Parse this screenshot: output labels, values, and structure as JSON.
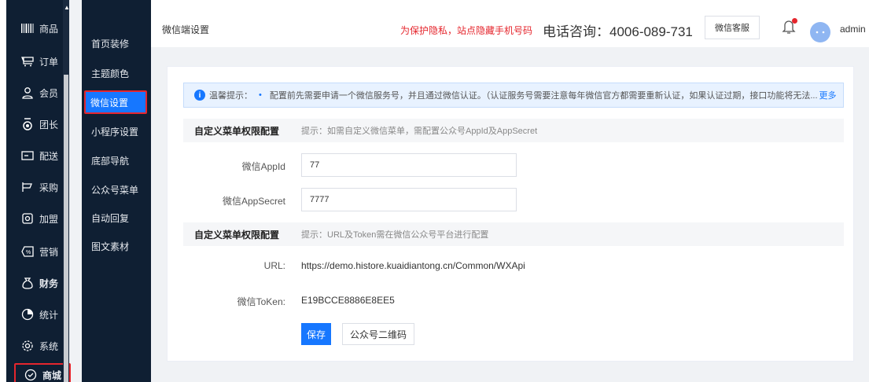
{
  "sidebar": {
    "items": [
      {
        "label": "商品",
        "icon": "barcode-icon"
      },
      {
        "label": "订单",
        "icon": "cart-icon"
      },
      {
        "label": "会员",
        "icon": "user-icon"
      },
      {
        "label": "团长",
        "icon": "leader-icon"
      },
      {
        "label": "配送",
        "icon": "truck-icon"
      },
      {
        "label": "采购",
        "icon": "purchase-icon"
      },
      {
        "label": "加盟",
        "icon": "franchise-icon"
      },
      {
        "label": "营销",
        "icon": "discount-icon"
      },
      {
        "label": "财务",
        "icon": "finance-icon"
      },
      {
        "label": "统计",
        "icon": "chart-icon"
      },
      {
        "label": "系统",
        "icon": "gear-icon"
      },
      {
        "label": "商城",
        "icon": "shop-icon"
      }
    ]
  },
  "subnav": {
    "items": [
      {
        "label": "首页装修"
      },
      {
        "label": "主题颜色"
      },
      {
        "label": "微信设置"
      },
      {
        "label": "小程序设置"
      },
      {
        "label": "底部导航"
      },
      {
        "label": "公众号菜单"
      },
      {
        "label": "自动回复"
      },
      {
        "label": "图文素材"
      }
    ]
  },
  "header": {
    "title": "微信端设置",
    "privacy_notice": "为保护隐私，站点隐藏手机号码",
    "phone": "电话咨询：4006-089-731",
    "service_button": "微信客服",
    "username": "admin"
  },
  "tip": {
    "title": "温馨提示：",
    "text": "配置前先需要申请一个微信服务号，并且通过微信认证。（认证服务号需要注意每年微信官方都需要重新认证，如果认证过期，接口功能将无法...",
    "more": "更多"
  },
  "section1": {
    "title": "自定义菜单权限配置",
    "hint": "提示：如需自定义微信菜单，需配置公众号AppId及AppSecret"
  },
  "form": {
    "appid_label": "微信AppId",
    "appid_value": "77",
    "secret_label": "微信AppSecret",
    "secret_value": "7777"
  },
  "section2": {
    "title": "自定义菜单权限配置",
    "hint": "提示：URL及Token需在微信公众号平台进行配置"
  },
  "info": {
    "url_label": "URL:",
    "url_value": "https://demo.histore.kuaidiantong.cn/Common/WXApi",
    "token_label": "微信ToKen:",
    "token_value": "E19BCCE8886E8EE5"
  },
  "buttons": {
    "save": "保存",
    "qrcode": "公众号二维码"
  },
  "colors": {
    "sidebar_bg": "#0f1f33",
    "accent": "#1677ff",
    "highlight": "#e5262d"
  }
}
